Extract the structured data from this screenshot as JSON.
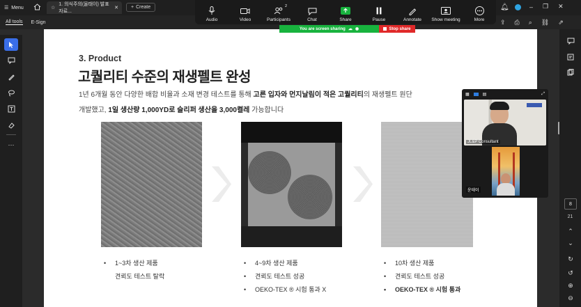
{
  "window": {
    "menu_label": "Menu",
    "tab_title": "1. 의식주의(율태이) 발표자료...",
    "new_tab_label": "Create"
  },
  "toolbar": {
    "all_tools": "All tools",
    "esign": "E-Sign"
  },
  "meeting": {
    "controls": [
      {
        "icon": "microphone-icon",
        "label": "Audio"
      },
      {
        "icon": "camera-icon",
        "label": "Video"
      },
      {
        "icon": "participants-icon",
        "label": "Participants",
        "badge": "2"
      },
      {
        "icon": "chat-icon",
        "label": "Chat"
      },
      {
        "icon": "share-icon",
        "label": "Share"
      },
      {
        "icon": "pause-icon",
        "label": "Pause"
      },
      {
        "icon": "annotate-icon",
        "label": "Annotate"
      },
      {
        "icon": "show-meeting-icon",
        "label": "Show meeting"
      },
      {
        "icon": "more-icon",
        "label": "More"
      }
    ],
    "sharing_status": "You are screen sharing",
    "stop_share": "Stop share",
    "participants": [
      {
        "name": "JL&P Consultant"
      },
      {
        "name": "윤태이"
      }
    ]
  },
  "slide": {
    "section": "3. Product",
    "title": "고퀄리티 수준의 재생펠트 완성",
    "desc_line1_a": "1년 6개월 동안 다양한 배합 비율과 소재 변경 테스트를 통해 ",
    "desc_line1_b": "고른 입자와 먼지날림이 적은 고퀄리티",
    "desc_line1_c": "의 재생펠트 원단",
    "desc_line2_a": "개발했고, ",
    "desc_line2_b": "1일 생산량 1,000YD로 슬리퍼 생산을 3,000켤레",
    "desc_line2_c": " 가능합니다",
    "products": [
      {
        "bullets": [
          "1~3차 생산 제품",
          "견뢰도 테스트 탈락"
        ]
      },
      {
        "bullets": [
          "4~9차 생산 제품",
          "견뢰도 테스트 성공",
          "OEKO-TEX ® 시험 통과 X"
        ]
      },
      {
        "bullets": [
          "10차 생산 제품",
          "견뢰도 테스트 성공",
          "OEKO-TEX ® 시험 통과"
        ]
      }
    ]
  },
  "page_nav": {
    "current_page": "8",
    "total_pages": "21"
  },
  "colors": {
    "share_green": "#18b33e",
    "stop_red": "#e02929",
    "select_blue": "#3a6ee8"
  }
}
